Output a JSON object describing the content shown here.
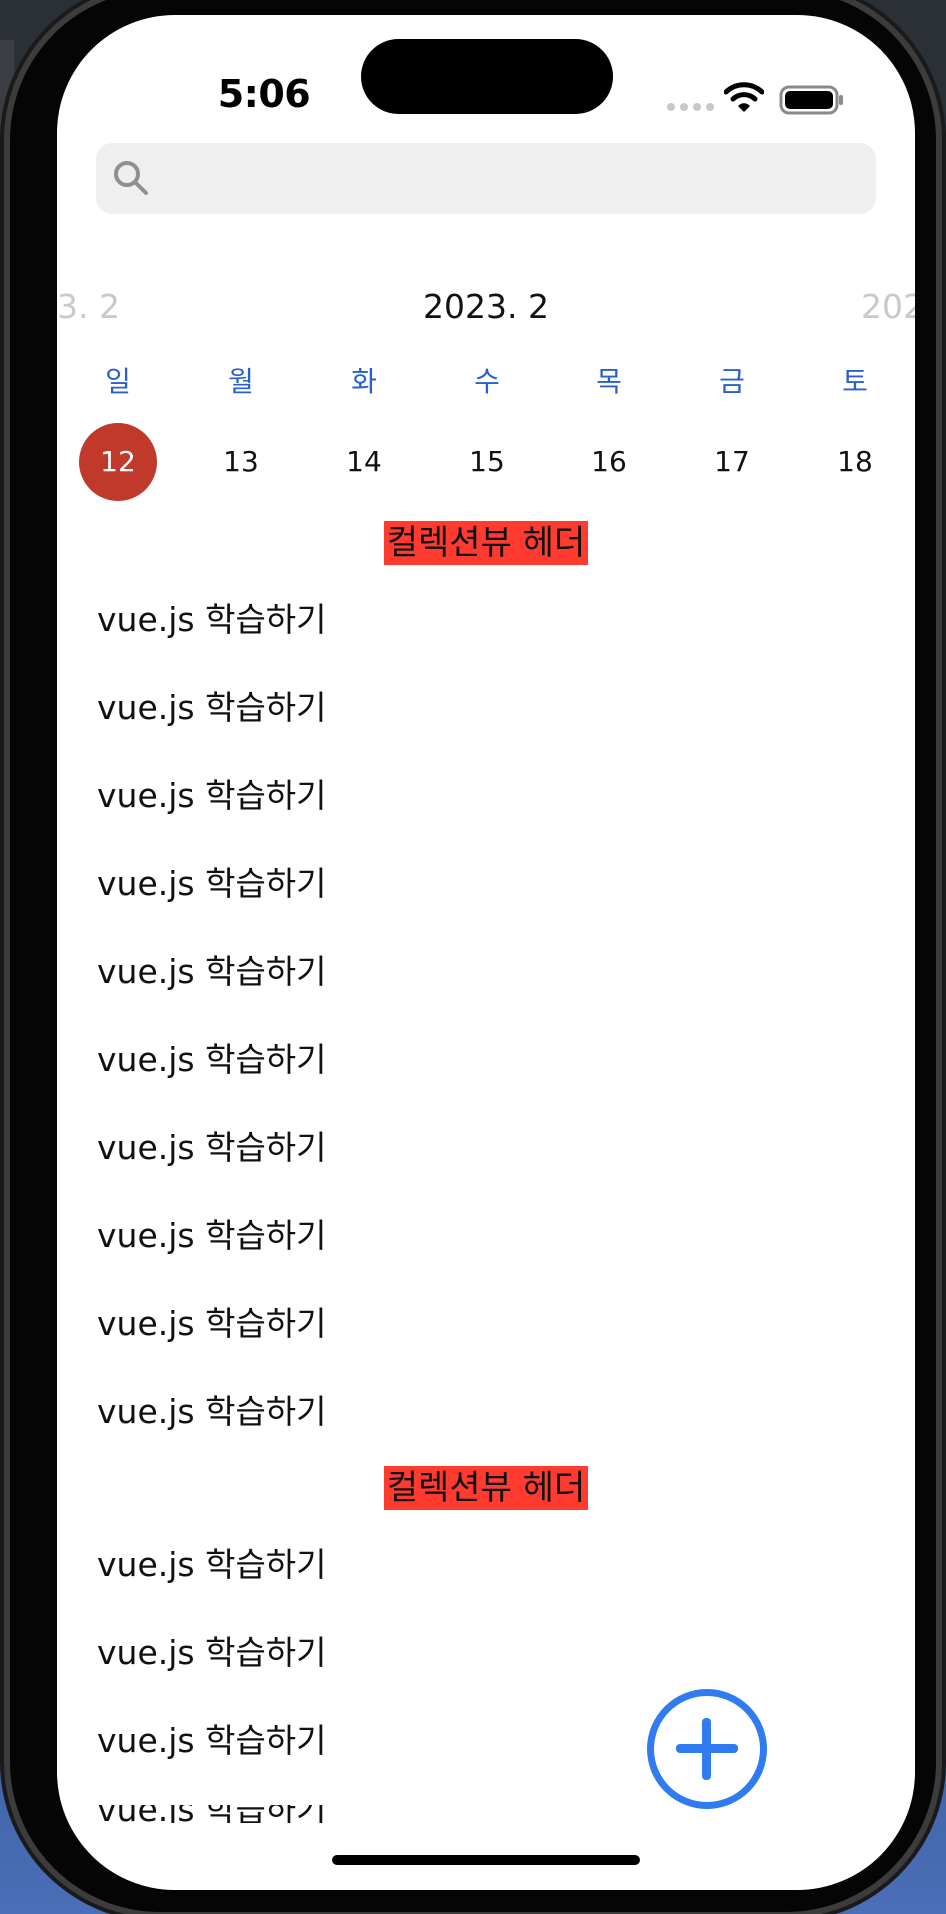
{
  "status_bar": {
    "time": "5:06"
  },
  "search": {
    "placeholder": ""
  },
  "calendar": {
    "prev_month": "3. 2",
    "current_month": "2023. 2",
    "next_month": "202",
    "weekdays": [
      "일",
      "월",
      "화",
      "수",
      "목",
      "금",
      "토"
    ],
    "dates": [
      "12",
      "13",
      "14",
      "15",
      "16",
      "17",
      "18"
    ],
    "selected_date": "12"
  },
  "sections": [
    {
      "header": "컬렉션뷰 헤더",
      "items": [
        "vue.js 학습하기",
        "vue.js 학습하기",
        "vue.js 학습하기",
        "vue.js 학습하기",
        "vue.js 학습하기",
        "vue.js 학습하기",
        "vue.js 학습하기",
        "vue.js 학습하기",
        "vue.js 학습하기",
        "vue.js 학습하기"
      ]
    },
    {
      "header": "컬렉션뷰 헤더",
      "items": [
        "vue.js 학습하기",
        "vue.js 학습하기",
        "vue.js 학습하기",
        "vue.js 학습하기"
      ]
    }
  ],
  "colors": {
    "accent": "#2f7bef",
    "weekday": "#2a5fd0",
    "selected": "#c0392b",
    "header_bg": "#ff3b30"
  },
  "icons": {
    "search": "search-icon",
    "add": "plus-circle-icon",
    "wifi": "wifi-icon",
    "battery": "battery-icon"
  }
}
